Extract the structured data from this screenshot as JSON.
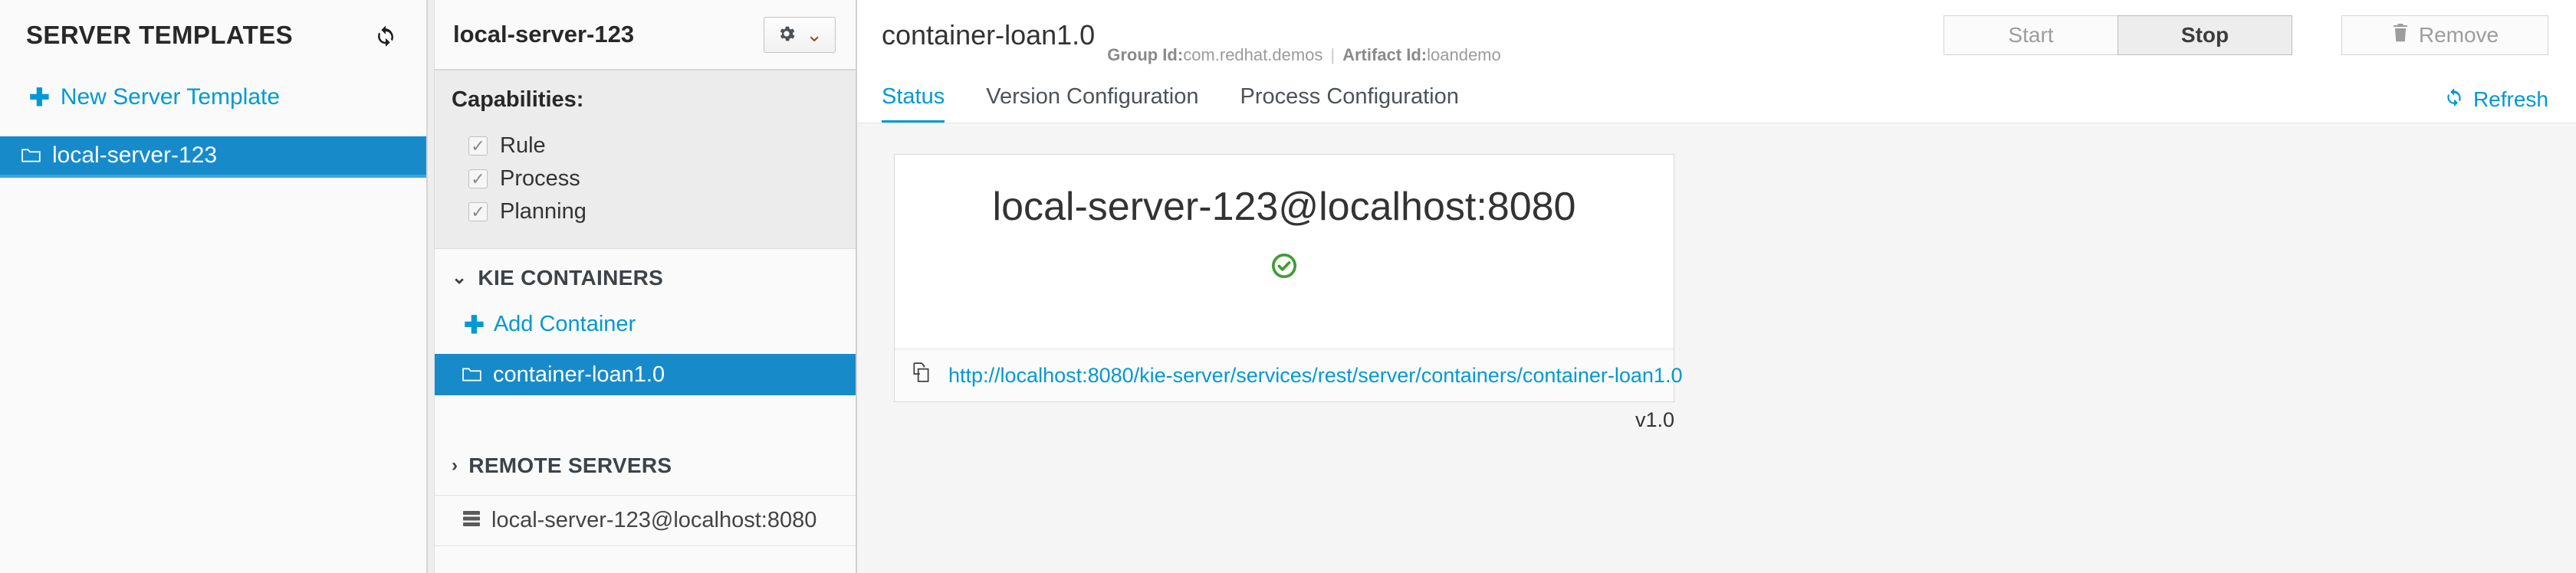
{
  "sidebar": {
    "title": "SERVER TEMPLATES",
    "refresh_icon": "refresh-icon",
    "new_template_label": "New Server Template",
    "items": [
      {
        "label": "local-server-123",
        "icon": "folder-icon",
        "selected": true
      }
    ]
  },
  "midpanel": {
    "title": "local-server-123",
    "gear_icon": "gear-icon",
    "caret_icon": "chevron-down-icon",
    "capabilities_label": "Capabilities:",
    "capabilities": [
      {
        "label": "Rule",
        "checked": true
      },
      {
        "label": "Process",
        "checked": true
      },
      {
        "label": "Planning",
        "checked": true
      }
    ],
    "kie_containers_header": "KIE CONTAINERS",
    "kie_containers_expanded": true,
    "add_container_label": "Add Container",
    "containers": [
      {
        "label": "container-loan1.0",
        "icon": "folder-icon",
        "selected": true
      }
    ],
    "remote_servers_header": "REMOTE SERVERS",
    "remote_servers_expanded": false,
    "remote_servers": [
      {
        "label": "local-server-123@localhost:8080",
        "icon": "server-icon"
      }
    ]
  },
  "content": {
    "title": "container-loan1.0",
    "group_id_label": "Group Id:",
    "group_id_value": "com.redhat.demos",
    "separator": "|",
    "artifact_id_label": "Artifact Id:",
    "artifact_id_value": "loandemo",
    "buttons": {
      "start": "Start",
      "stop": "Stop",
      "remove": "Remove",
      "remove_icon": "trash-icon"
    },
    "tabs": [
      {
        "label": "Status",
        "active": true
      },
      {
        "label": "Version Configuration",
        "active": false
      },
      {
        "label": "Process Configuration",
        "active": false
      }
    ],
    "refresh_label": "Refresh",
    "refresh_icon": "refresh-icon",
    "status_card": {
      "server_name": "local-server-123@localhost:8080",
      "status_icon": "check-circle-icon",
      "status_color": "#3f9c35",
      "copy_icon": "copy-icon",
      "url": "http://localhost:8080/kie-server/services/rest/server/containers/container-loan1.0",
      "version": "v1.0"
    }
  },
  "colors": {
    "accent": "#0099d3",
    "selected_row": "#178bca",
    "success": "#3f9c35",
    "panel_bg": "#fafafa",
    "content_bg": "#f5f5f5"
  }
}
